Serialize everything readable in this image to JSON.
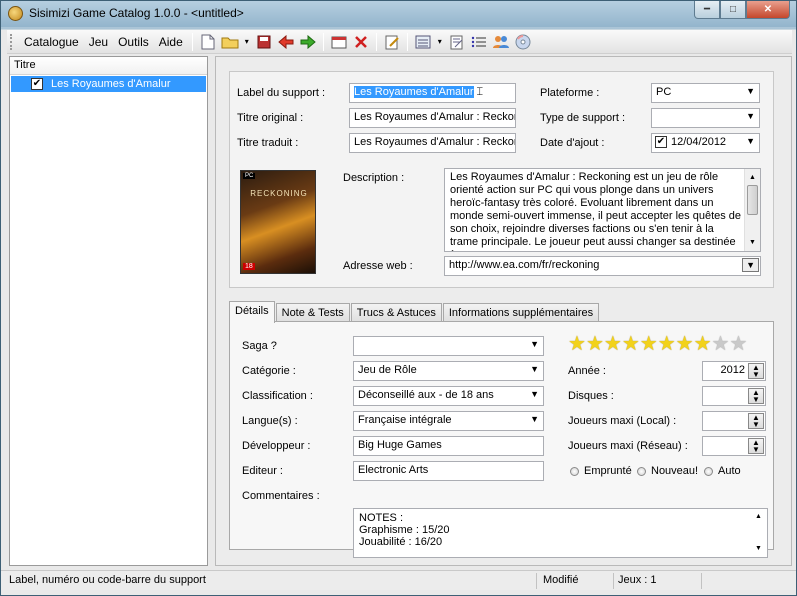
{
  "window": {
    "title": "Sisimizi Game Catalog 1.0.0 - <untitled>",
    "controls": [
      "minimize",
      "maximize",
      "close"
    ]
  },
  "menu": [
    "Catalogue",
    "Jeu",
    "Outils",
    "Aide"
  ],
  "toolbar": [
    "new-icon",
    "open-icon",
    "save-icon",
    "back-icon",
    "forward-icon",
    "new-game-icon",
    "delete-icon",
    "edit-icon",
    "view-icon",
    "edit-list-icon",
    "list-icon",
    "users-icon",
    "disc-icon"
  ],
  "game_list": {
    "column_header": "Titre",
    "items": [
      {
        "title": "Les Royaumes d'Amalur",
        "checked": true
      }
    ]
  },
  "details_top": {
    "label_support": {
      "label": "Label du support :",
      "value": "Les Royaumes d'Amalur"
    },
    "titre_original": {
      "label": "Titre original :",
      "value": "Les Royaumes d'Amalur : Reckoning"
    },
    "titre_traduit": {
      "label": "Titre traduit :",
      "value": "Les Royaumes d'Amalur : Reckoning"
    },
    "plateforme": {
      "label": "Plateforme :",
      "value": "PC"
    },
    "type_support": {
      "label": "Type de support :",
      "value": ""
    },
    "date_ajout": {
      "label": "Date d'ajout :",
      "value": "12/04/2012",
      "checked": true
    },
    "description": {
      "label": "Description :",
      "value": "Les Royaumes d'Amalur : Reckoning est un jeu de rôle orienté action sur PC qui vous plonge dans un univers heroïc-fantasy très coloré. Evoluant librement dans un monde semi-ouvert immense, il peut accepter les quêtes de son choix, rejoindre diverses factions ou s'en tenir à la trame principale. Le joueur peut aussi changer sa destinée à"
    },
    "adresse_web": {
      "label": "Adresse web :",
      "value": "http://www.ea.com/fr/reckoning"
    },
    "cover": {
      "platform_badge": "PC",
      "title": "RECKONING",
      "age": "18"
    }
  },
  "tabs": [
    {
      "label": "Détails",
      "active": true
    },
    {
      "label": "Note & Tests",
      "active": false
    },
    {
      "label": "Trucs & Astuces",
      "active": false
    },
    {
      "label": "Informations supplémentaires",
      "active": false
    }
  ],
  "details": {
    "saga": {
      "label": "Saga ?",
      "value": ""
    },
    "categorie": {
      "label": "Catégorie :",
      "value": "Jeu de Rôle"
    },
    "classification": {
      "label": "Classification :",
      "value": "Déconseillé aux - de 18 ans"
    },
    "langue": {
      "label": "Langue(s) :",
      "value": "Française intégrale"
    },
    "developpeur": {
      "label": "Développeur :",
      "value": "Big Huge Games"
    },
    "editeur": {
      "label": "Editeur :",
      "value": "Electronic Arts"
    },
    "commentaires": {
      "label": "Commentaires :",
      "lines": [
        "NOTES :",
        "Graphisme : 15/20",
        "Jouabilité : 16/20"
      ]
    },
    "rating": {
      "filled": 8,
      "total": 10,
      "color_filled": "#f2d21b",
      "color_empty": "#c9c9c9"
    },
    "annee": {
      "label": "Année :",
      "value": "2012"
    },
    "disques": {
      "label": "Disques :",
      "value": ""
    },
    "joueurs_local": {
      "label": "Joueurs maxi (Local) :",
      "value": ""
    },
    "joueurs_reseau": {
      "label": "Joueurs maxi (Réseau) :",
      "value": ""
    },
    "options": [
      {
        "label": "Emprunté",
        "selected": false
      },
      {
        "label": "Nouveau!",
        "selected": false
      },
      {
        "label": "Auto",
        "selected": false
      }
    ]
  },
  "statusbar": {
    "hint": "Label, numéro ou code-barre du support",
    "state": "Modifié",
    "count": "Jeux : 1"
  }
}
